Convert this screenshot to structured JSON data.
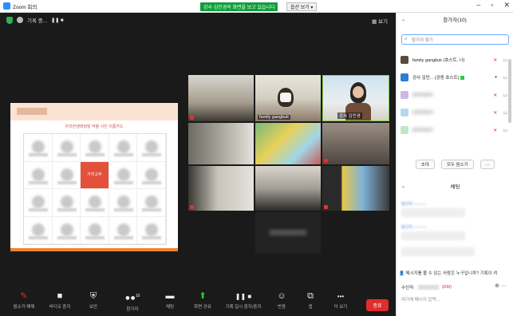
{
  "window": {
    "title": "Zoom 회의",
    "share_banner": "강사 김민경의 화면을 보고 있습니다",
    "view_options": "옵션 보기 ▾",
    "min": "–",
    "max": "▫",
    "close": "✕"
  },
  "meeting": {
    "recording_label": "기록 중...",
    "pause_label": "❚❚ ■",
    "gallery_label": "▦ 보기",
    "slide_title": "우리반생태텃밭 작물 사진 이름카드",
    "highlight_card": "가지고추",
    "tiles": [
      {
        "name": "family gangbuk"
      },
      {
        "name": "강사 김민경"
      }
    ]
  },
  "controls": [
    {
      "icon": "mic-off-icon",
      "glyph": "🎙",
      "label": "음소거 해제"
    },
    {
      "icon": "video-icon",
      "glyph": "■",
      "label": "비디오 중지"
    },
    {
      "icon": "shield-icon",
      "glyph": "⛨",
      "label": "보안"
    },
    {
      "icon": "participants-icon",
      "glyph": "👥",
      "label": "참가자",
      "count": "10"
    },
    {
      "icon": "chat-icon",
      "glyph": "▬",
      "label": "채팅"
    },
    {
      "icon": "share-screen-icon",
      "glyph": "⬆",
      "label": "화면 공유"
    },
    {
      "icon": "record-icon",
      "glyph": "❚❚ ■",
      "label": "기록 일시 중지/중지"
    },
    {
      "icon": "reaction-icon",
      "glyph": "☺",
      "label": "반응"
    },
    {
      "icon": "apps-icon",
      "glyph": "⧉",
      "label": "앱"
    },
    {
      "icon": "more-icon",
      "glyph": "•••",
      "label": "더 보기"
    }
  ],
  "end_label": "종료",
  "panel": {
    "participants_title": "참가자(10)",
    "search_placeholder": "참가자 찾기",
    "participants": [
      {
        "name": "family gangbuk (호스트, 나)",
        "color": "#5a4a3a",
        "blur": false
      },
      {
        "name": "강사 김민... (공동 호스트)",
        "color": "#2d7dd2",
        "blur": false,
        "badge": true
      },
      {
        "name": "participant",
        "color": "#c9b9e8",
        "blur": true
      },
      {
        "name": "participant",
        "color": "#b5d8f0",
        "blur": true
      },
      {
        "name": "participant",
        "color": "#bde8c5",
        "blur": true
      }
    ],
    "invite_btn": "초대",
    "mute_all_btn": "모두 음소거",
    "more_btn": "...",
    "chat_title": "채팅",
    "chat_warning": "메시지를 볼 수 있는 사람은 누구입니까? 기록이 켜",
    "recipient_label": "수신자:",
    "dm_label": "(DM)",
    "input_placeholder": "여기에 메시지 입력..."
  }
}
